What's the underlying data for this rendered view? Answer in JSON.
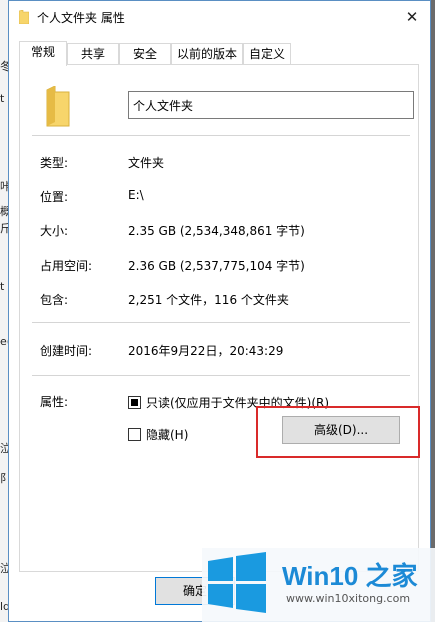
{
  "window": {
    "title": "个人文件夹 属性",
    "close_glyph": "✕"
  },
  "tabs": [
    {
      "label": "常规"
    },
    {
      "label": "共享"
    },
    {
      "label": "安全"
    },
    {
      "label": "以前的版本"
    },
    {
      "label": "自定义"
    }
  ],
  "folder_name": "个人文件夹",
  "properties": {
    "type_label": "类型:",
    "type_value": "文件夹",
    "location_label": "位置:",
    "location_value": "E:\\",
    "size_label": "大小:",
    "size_value": "2.35 GB (2,534,348,861 字节)",
    "disk_size_label": "占用空间:",
    "disk_size_value": "2.36 GB (2,537,775,104 字节)",
    "contains_label": "包含:",
    "contains_value": "2,251 个文件，116 个文件夹",
    "created_label": "创建时间:",
    "created_value": "2016年9月22日，20:43:29",
    "attributes_label": "属性:"
  },
  "attributes": {
    "readonly_label": "只读(仅应用于文件夹中的文件)(R)",
    "readonly_state": "indeterminate",
    "hidden_label": "隐藏(H)",
    "hidden_state": "unchecked",
    "advanced_button": "高级(D)..."
  },
  "footer": {
    "ok_button": "确定"
  },
  "watermark": {
    "title": "Win10 之家",
    "url": "www.win10xitong.com"
  },
  "background_fragments": [
    "冬",
    "t",
    "咔",
    "概",
    "斤",
    "t",
    "e(",
    "泣",
    "阝",
    "泣",
    "ld"
  ],
  "colors": {
    "highlight_box": "#d92a2a",
    "folder": "#f7d56b",
    "window_border": "#5a8fc3",
    "win_logo": "#1a9ae0"
  },
  "icons": {
    "title_icon": "folder-icon",
    "close": "close-icon",
    "large_folder": "folder-icon",
    "watermark_logo": "windows-logo-icon"
  }
}
